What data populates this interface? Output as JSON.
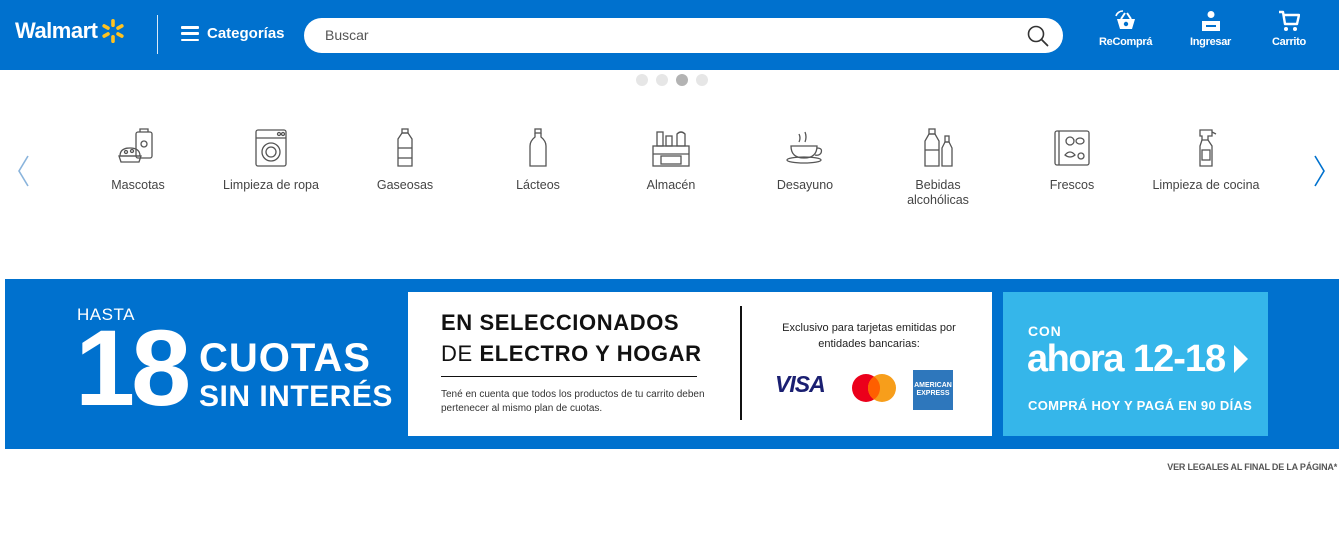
{
  "header": {
    "logo_text": "Walmart",
    "categories_label": "Categorías",
    "search_placeholder": "Buscar",
    "recompra_label": "ReComprá",
    "ingresar_label": "Ingresar",
    "carrito_label": "Carrito",
    "brand_color": "#0071ce",
    "spark_color": "#ffc220"
  },
  "carousel": {
    "dots": 4,
    "active_dot": 3
  },
  "categories": [
    {
      "label": "Mascotas",
      "icon": "pet-food-icon"
    },
    {
      "label": "Limpieza de ropa",
      "icon": "washing-machine-icon"
    },
    {
      "label": "Gaseosas",
      "icon": "soda-bottle-icon"
    },
    {
      "label": "Lácteos",
      "icon": "milk-bottle-icon"
    },
    {
      "label": "Almacén",
      "icon": "pantry-icon"
    },
    {
      "label": "Desayuno",
      "icon": "coffee-cup-icon"
    },
    {
      "label": "Bebidas alcohólicas",
      "icon": "wine-bottles-icon"
    },
    {
      "label": "Frescos",
      "icon": "fridge-icon"
    },
    {
      "label": "Limpieza de cocina",
      "icon": "spray-bottle-icon"
    }
  ],
  "banner": {
    "hasta": "HASTA",
    "number": "18",
    "cuotas": "CUOTAS",
    "sin_interes": "SIN INTERÉS",
    "en_seleccionados": "EN SELECCIONADOS",
    "de": "DE",
    "electro_hogar": "ELECTRO Y HOGAR",
    "tene_en_cuenta": "Tené en cuenta que todos los productos de tu carrito deben pertenecer al mismo plan de cuotas.",
    "exclusivo": "Exclusivo para tarjetas emitidas por entidades bancarias:",
    "visa": "VISA",
    "amex_line1": "AMERICAN",
    "amex_line2": "EXPRESS",
    "con": "CON",
    "ahora": "ahora",
    "ahora_numbers": "12-18",
    "compra_hoy": "COMPRÁ HOY Y PAGÁ EN 90 DÍAS",
    "light_blue": "#35b6ea"
  },
  "footer_note": "VER LEGALES AL FINAL DE LA PÁGINA*"
}
